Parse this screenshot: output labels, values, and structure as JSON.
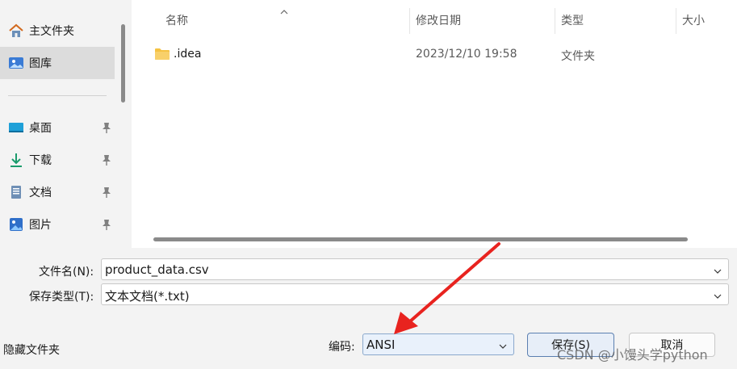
{
  "nav": {
    "items": [
      {
        "label": "主文件夹",
        "icon": "home-icon",
        "pinned": false,
        "selected": false
      },
      {
        "label": "图库",
        "icon": "gallery-icon",
        "pinned": false,
        "selected": true
      },
      {
        "label": "桌面",
        "icon": "desktop-icon",
        "pinned": true,
        "selected": false
      },
      {
        "label": "下载",
        "icon": "download-icon",
        "pinned": true,
        "selected": false
      },
      {
        "label": "文档",
        "icon": "document-icon",
        "pinned": true,
        "selected": false
      },
      {
        "label": "图片",
        "icon": "pictures-icon",
        "pinned": true,
        "selected": false
      }
    ]
  },
  "list": {
    "columns": [
      "名称",
      "修改日期",
      "类型",
      "大小"
    ],
    "rows": [
      {
        "name": ".idea",
        "modified": "2023/12/10 19:58",
        "type": "文件夹",
        "icon": "folder-icon"
      }
    ]
  },
  "form": {
    "filename_label": "文件名(N):",
    "filename_value": "product_data.csv",
    "filetype_label": "保存类型(T):",
    "filetype_value": "文本文档(*.txt)",
    "hide_folders_label": "隐藏文件夹",
    "encoding_label": "编码:",
    "encoding_value": "ANSI",
    "save_label": "保存(S)",
    "cancel_label": "取消"
  },
  "watermark": "CSDN @小馒头学python",
  "colors": {
    "arrow": "#e8231f",
    "folder": "#f5c242",
    "selection": "#dcdcdc"
  }
}
